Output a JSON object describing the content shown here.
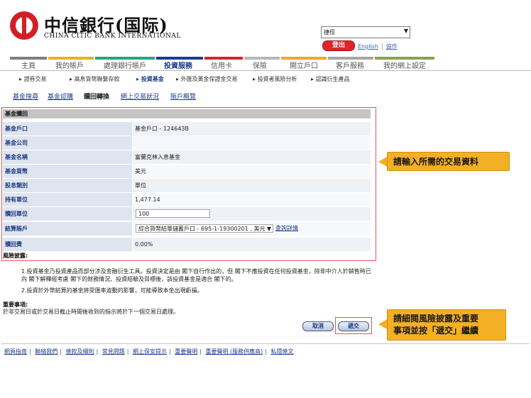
{
  "brand": {
    "name_cn": "中信銀行(国际)",
    "name_en": "CHINA CITIC BANK INTERNATIONAL"
  },
  "header": {
    "quicklink": {
      "value": "捷徑",
      "arrow": "▼"
    },
    "logout_label": "登出",
    "english_label": "English",
    "help_label": "協作"
  },
  "colors": {
    "brand_red": "#d21f26",
    "nav_active": "#1c3d8a",
    "label_blue": "#1e3c82",
    "callout_orange": "#f4b025"
  },
  "colorbar": [
    "#7e7e7e",
    "#e1b524",
    "#2aa37b",
    "#1c3d8a",
    "#d3242f",
    "#b7b7b7",
    "#f0a72c",
    "#a5a5a5",
    "#8aa14b"
  ],
  "mainnav": {
    "items": [
      {
        "label": "主頁"
      },
      {
        "label": "我的賬戶"
      },
      {
        "label": "處理銀行賬戶"
      },
      {
        "label": "投資服務"
      },
      {
        "label": "信用卡"
      },
      {
        "label": "保險"
      },
      {
        "label": "開立戶口"
      },
      {
        "label": "客戶服務"
      },
      {
        "label": "我的網上設定"
      }
    ]
  },
  "subnav": {
    "items": [
      {
        "label": "證券交易"
      },
      {
        "label": "高息貨幣聯繫存款"
      },
      {
        "label": "投資基金"
      },
      {
        "label": "外匯及黃金保證金交易"
      },
      {
        "label": "投資者風險分析"
      },
      {
        "label": "認識衍生產品"
      }
    ]
  },
  "tabs": {
    "items": [
      {
        "label": "基金搜尋"
      },
      {
        "label": "基金認購"
      },
      {
        "label": "贖回轉換"
      },
      {
        "label": "網上交易狀況"
      },
      {
        "label": "賬戶概覽"
      }
    ]
  },
  "form": {
    "title": "基金贖回",
    "rows": [
      {
        "label": "基金戶口",
        "value": "基金戶口 - 124643B"
      },
      {
        "label": "基金公司",
        "value": ""
      },
      {
        "label": "基金名稱",
        "value": "富蘭克林入息基金"
      },
      {
        "label": "基金貨幣",
        "value": "美元"
      },
      {
        "label": "股息類別",
        "value": "單位"
      },
      {
        "label": "持有單位",
        "value": "1,477.14"
      },
      {
        "label": "贖回單位",
        "value": "100"
      },
      {
        "label": "結算賬戶",
        "value": "綜合貨幣結單儲蓄戶口 - 695-1-19300201 , 美元"
      },
      {
        "label": "贖回費",
        "value": "0.00%"
      }
    ],
    "select_arrow": "▼",
    "query_link": "查詢詳情"
  },
  "risk": {
    "title": "風險披露:",
    "p1": "1.投資基金乃投資產品而部分涉及金融衍生工具。投資決定是由 閣下自行作出的，但 閣下不應投資在任何投資基金，除非中介人於銷售時已向 閣下解釋經考慮 閣下的財務情況、投資經驗及目標後，該投資基金是適合 閣下的。",
    "p2": "2.投資於外幣結算的基金將受匯率波動的影響，可能導致本金出現虧損。"
  },
  "notice": {
    "title": "重要事項:",
    "text": "於非交易日或於交易日截止時間後收到的指示將於下一個交易日處理。"
  },
  "buttons": {
    "cancel": "取消",
    "submit": "遞交"
  },
  "callouts": {
    "c1": "請輸入所需的交易資料",
    "c2_line1": "請細閱風險披露及重要",
    "c2_line2": "事項並按「遞交」繼續"
  },
  "footer": {
    "links": [
      "網頁指南",
      "聯絡我們",
      "條款及細則",
      "常見問題",
      "網上保安提示",
      "重要聲明",
      "重要聲明 (服務供應商)",
      "私隱條文"
    ]
  }
}
